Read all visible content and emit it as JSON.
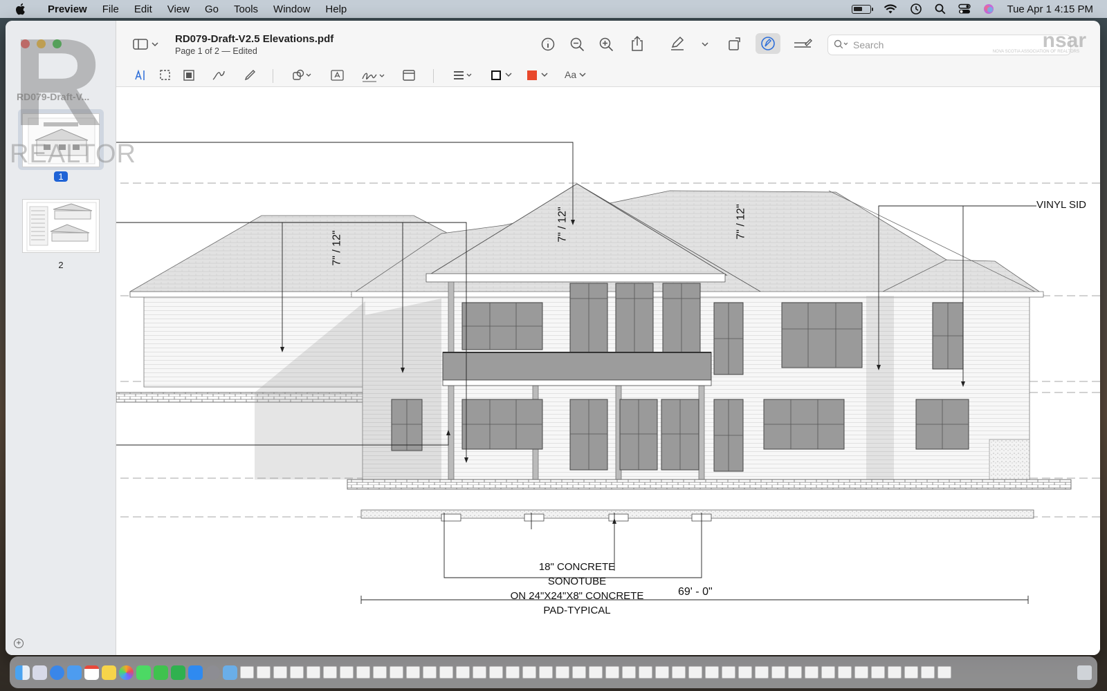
{
  "menubar": {
    "app": "Preview",
    "items": [
      "File",
      "Edit",
      "View",
      "Go",
      "Tools",
      "Window",
      "Help"
    ],
    "clock": "Tue Apr 1  4:15 PM"
  },
  "window": {
    "sidebar_title": "RD079-Draft-V...",
    "pages": [
      "1",
      "2"
    ],
    "doc_title": "RD079-Draft-V2.5 Elevations.pdf",
    "doc_subtitle": "Page 1 of 2 — Edited",
    "search_placeholder": "Search",
    "font_label": "Aa",
    "accent_color": "#1f63d6",
    "fill_color": "#e8482c"
  },
  "drawing": {
    "pitch_1": "7\" / 12\"",
    "pitch_2": "7\" / 12\"",
    "pitch_3": "7\" / 12\"",
    "vinyl_label": "VINYL SID",
    "sonotube_line1": "18\" CONCRETE SONOTUBE",
    "sonotube_line2": "ON 24\"X24\"X8\" CONCRETE",
    "sonotube_line3": "PAD-TYPICAL",
    "dimension": "69' - 0\""
  },
  "watermarks": {
    "r_mark": "R",
    "realtor": "REALTOR",
    "nsar": "nsar",
    "nsar_sub": "NOVA SCOTIA ASSOCIATION OF REALTORS"
  },
  "dock_icons": [
    "finder-icon",
    "launchpad-icon",
    "safari-icon",
    "mail-icon",
    "calendar-icon",
    "notes-icon",
    "photos-icon",
    "messages-icon",
    "facetime-icon",
    "numbers-icon",
    "app-store-icon",
    "settings-icon",
    "preview-icon"
  ]
}
